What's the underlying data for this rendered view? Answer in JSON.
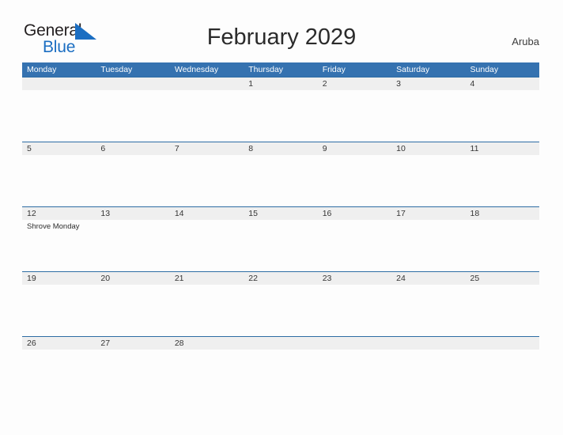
{
  "brand": {
    "name_part1": "General",
    "name_part2": "Blue",
    "flag_color": "#1b6ec2",
    "text_color": "#231f20"
  },
  "header": {
    "title": "February 2029",
    "locale": "Aruba"
  },
  "theme": {
    "header_blue": "#3572b0",
    "row_border_blue": "#2e6da4",
    "date_strip_gray": "#efefef",
    "page_background": "#fdfdfd",
    "text_dark": "#353535"
  },
  "calendar": {
    "month": "February",
    "year": "2029",
    "weekdays": [
      "Monday",
      "Tuesday",
      "Wednesday",
      "Thursday",
      "Friday",
      "Saturday",
      "Sunday"
    ],
    "weeks": [
      [
        {
          "day": "",
          "events": []
        },
        {
          "day": "",
          "events": []
        },
        {
          "day": "",
          "events": []
        },
        {
          "day": "1",
          "events": []
        },
        {
          "day": "2",
          "events": []
        },
        {
          "day": "3",
          "events": []
        },
        {
          "day": "4",
          "events": []
        }
      ],
      [
        {
          "day": "5",
          "events": []
        },
        {
          "day": "6",
          "events": []
        },
        {
          "day": "7",
          "events": []
        },
        {
          "day": "8",
          "events": []
        },
        {
          "day": "9",
          "events": []
        },
        {
          "day": "10",
          "events": []
        },
        {
          "day": "11",
          "events": []
        }
      ],
      [
        {
          "day": "12",
          "events": [
            "Shrove Monday"
          ]
        },
        {
          "day": "13",
          "events": []
        },
        {
          "day": "14",
          "events": []
        },
        {
          "day": "15",
          "events": []
        },
        {
          "day": "16",
          "events": []
        },
        {
          "day": "17",
          "events": []
        },
        {
          "day": "18",
          "events": []
        }
      ],
      [
        {
          "day": "19",
          "events": []
        },
        {
          "day": "20",
          "events": []
        },
        {
          "day": "21",
          "events": []
        },
        {
          "day": "22",
          "events": []
        },
        {
          "day": "23",
          "events": []
        },
        {
          "day": "24",
          "events": []
        },
        {
          "day": "25",
          "events": []
        }
      ],
      [
        {
          "day": "26",
          "events": []
        },
        {
          "day": "27",
          "events": []
        },
        {
          "day": "28",
          "events": []
        },
        {
          "day": "",
          "events": []
        },
        {
          "day": "",
          "events": []
        },
        {
          "day": "",
          "events": []
        },
        {
          "day": "",
          "events": []
        }
      ]
    ]
  }
}
